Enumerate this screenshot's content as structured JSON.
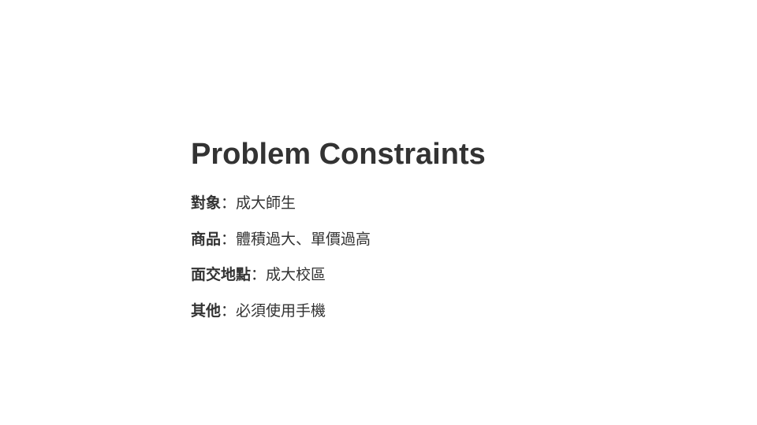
{
  "slide": {
    "title": "Problem Constraints",
    "separator": "：",
    "constraints": [
      {
        "label": "對象",
        "value": "成大師生"
      },
      {
        "label": "商品",
        "value": "體積過大、單價過高"
      },
      {
        "label": "面交地點",
        "value": "成大校區"
      },
      {
        "label": "其他",
        "value": "必須使用手機"
      }
    ]
  }
}
